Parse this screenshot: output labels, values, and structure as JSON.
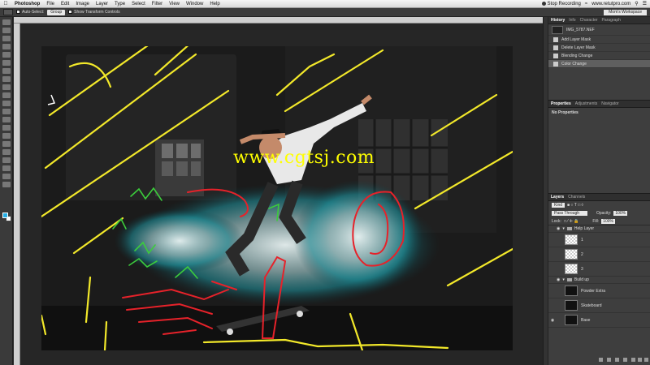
{
  "menubar": {
    "app": "Photoshop",
    "items": [
      "File",
      "Edit",
      "Image",
      "Layer",
      "Type",
      "Select",
      "Filter",
      "View",
      "Window",
      "Help"
    ],
    "stop_recording": "Stop Recording",
    "url": "www.retutpro.com"
  },
  "options": {
    "auto_select": "Auto-Select:",
    "group": "Group",
    "show_transform": "Show Transform Controls",
    "workspace": "Mom's Workspace"
  },
  "canvas": {
    "watermark": "www.cgtsj.com"
  },
  "history": {
    "tabs": [
      "History",
      "Info",
      "Character",
      "Paragraph"
    ],
    "snapshot": "IMG_5787.NEF",
    "items": [
      "Add Layer Mask",
      "Delete Layer Mask",
      "Blending Change",
      "Color Change"
    ]
  },
  "properties": {
    "tabs": [
      "Properties",
      "Adjustments",
      "Navigator"
    ],
    "empty": "No Properties"
  },
  "layers": {
    "tabs": [
      "Layers",
      "Channels"
    ],
    "kind": "Kind",
    "blend_mode": "Pass Through",
    "opacity_label": "Opacity:",
    "opacity": "100%",
    "lock_label": "Lock:",
    "fill_label": "Fill:",
    "fill": "100%",
    "help_group": "Help Layer",
    "help_layers": [
      "1",
      "2",
      "3"
    ],
    "build_group": "Build up",
    "build_layers": [
      "Powder Extra",
      "Skateboard",
      "Base"
    ]
  },
  "colors": {
    "foreground": "#27b0e6",
    "background": "#ffffff",
    "annotation_yellow": "#f2e82a",
    "annotation_green": "#3ccc3c",
    "annotation_red": "#e6222a"
  }
}
